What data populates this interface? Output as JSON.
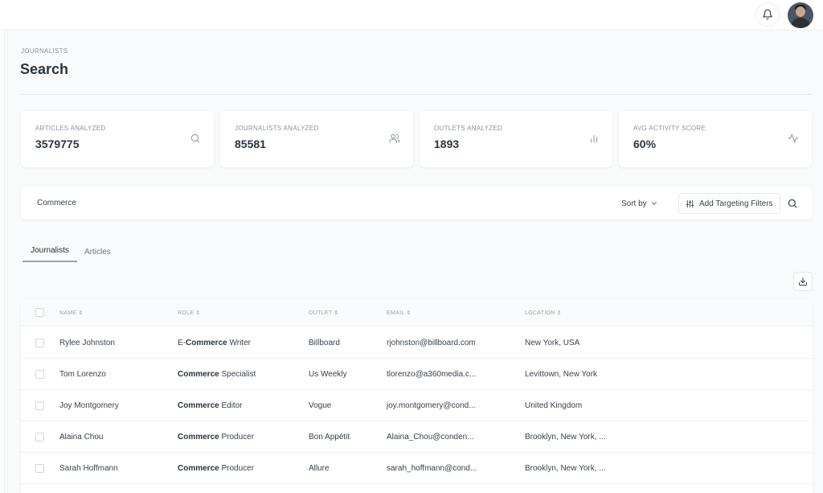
{
  "header": {
    "bell_icon": "bell-icon",
    "avatar": "user-avatar"
  },
  "page": {
    "breadcrumb": "JOURNALISTS",
    "title": "Search"
  },
  "stats": [
    {
      "label": "ARTICLES ANALYZED",
      "value": "3579775",
      "icon": "search-icon"
    },
    {
      "label": "JOURNALISTS ANALYZED",
      "value": "85581",
      "icon": "users-icon"
    },
    {
      "label": "OUTLETS ANALYZED",
      "value": "1893",
      "icon": "bar-chart-icon"
    },
    {
      "label": "AVG ACTIVITY SCORE",
      "value": "60%",
      "icon": "activity-icon"
    }
  ],
  "search": {
    "query": "Commerce",
    "sort_label": "Sort by",
    "filters_label": "Add Targeting Filters"
  },
  "tabs": [
    {
      "label": "Journalists",
      "active": true
    },
    {
      "label": "Articles",
      "active": false
    }
  ],
  "table": {
    "columns": [
      "NAME",
      "ROLE",
      "OUTLET",
      "EMAIL",
      "LOCATION"
    ],
    "rows": [
      {
        "name": "Rylee Johnston",
        "role_pre": "E-",
        "role_hl": "Commerce",
        "role_post": " Writer",
        "outlet": "Billboard",
        "email": "rjohnston@billboard.com",
        "location": "New York, USA"
      },
      {
        "name": "Tom Lorenzo",
        "role_pre": "",
        "role_hl": "Commerce",
        "role_post": " Specialist",
        "outlet": "Us Weekly",
        "email": "tlorenzo@a360media.c...",
        "location": "Levittown, New York"
      },
      {
        "name": "Joy Montgomery",
        "role_pre": "",
        "role_hl": "Commerce",
        "role_post": " Editor",
        "outlet": "Vogue",
        "email": "joy.montgomery@cond...",
        "location": "United Kingdom"
      },
      {
        "name": "Alaina Chou",
        "role_pre": "",
        "role_hl": "Commerce",
        "role_post": " Producer",
        "outlet": "Bon Appétit",
        "email": "Alaina_Chou@conden...",
        "location": "Brooklyn, New York, ..."
      },
      {
        "name": "Sarah Hoffmann",
        "role_pre": "",
        "role_hl": "Commerce",
        "role_post": " Producer",
        "outlet": "Allure",
        "email": "sarah_hoffmann@cond...",
        "location": "Brooklyn, New York, ..."
      }
    ]
  }
}
